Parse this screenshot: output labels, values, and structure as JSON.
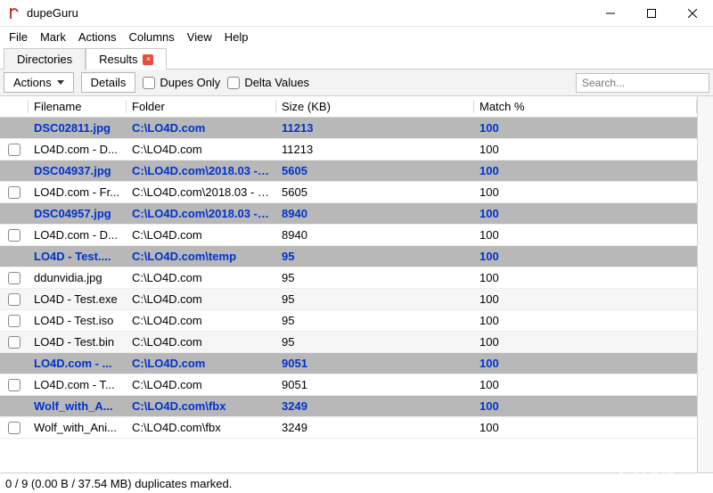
{
  "window": {
    "title": "dupeGuru"
  },
  "menubar": [
    "File",
    "Mark",
    "Actions",
    "Columns",
    "View",
    "Help"
  ],
  "tabs": {
    "items": [
      "Directories",
      "Results"
    ],
    "active": 1,
    "closable": [
      false,
      true
    ]
  },
  "toolbar": {
    "actions_label": "Actions",
    "details_label": "Details",
    "dupes_only_label": "Dupes Only",
    "delta_values_label": "Delta Values",
    "search_placeholder": "Search..."
  },
  "columns": {
    "checkbox": "",
    "filename": "Filename",
    "folder": "Folder",
    "size": "Size (KB)",
    "match": "Match %"
  },
  "rows": [
    {
      "group": true,
      "filename": "DSC02811.jpg",
      "folder": "C:\\LO4D.com",
      "size": "11213",
      "match": "100"
    },
    {
      "group": false,
      "checkbox": true,
      "filename": "LO4D.com - D...",
      "folder": "C:\\LO4D.com",
      "size": "11213",
      "match": "100",
      "alt": false
    },
    {
      "group": true,
      "filename": "DSC04937.jpg",
      "folder": "C:\\LO4D.com\\2018.03 - G...",
      "size": "5605",
      "match": "100"
    },
    {
      "group": false,
      "checkbox": true,
      "filename": "LO4D.com - Fr...",
      "folder": "C:\\LO4D.com\\2018.03 - Gib...",
      "size": "5605",
      "match": "100",
      "alt": false
    },
    {
      "group": true,
      "filename": "DSC04957.jpg",
      "folder": "C:\\LO4D.com\\2018.03 - G...",
      "size": "8940",
      "match": "100"
    },
    {
      "group": false,
      "checkbox": true,
      "filename": "LO4D.com - D...",
      "folder": "C:\\LO4D.com",
      "size": "8940",
      "match": "100",
      "alt": false
    },
    {
      "group": true,
      "filename": "LO4D - Test....",
      "folder": "C:\\LO4D.com\\temp",
      "size": "95",
      "match": "100"
    },
    {
      "group": false,
      "checkbox": true,
      "filename": "ddunvidia.jpg",
      "folder": "C:\\LO4D.com",
      "size": "95",
      "match": "100",
      "alt": false
    },
    {
      "group": false,
      "checkbox": true,
      "filename": "LO4D - Test.exe",
      "folder": "C:\\LO4D.com",
      "size": "95",
      "match": "100",
      "alt": true
    },
    {
      "group": false,
      "checkbox": true,
      "filename": "LO4D - Test.iso",
      "folder": "C:\\LO4D.com",
      "size": "95",
      "match": "100",
      "alt": false
    },
    {
      "group": false,
      "checkbox": true,
      "filename": "LO4D - Test.bin",
      "folder": "C:\\LO4D.com",
      "size": "95",
      "match": "100",
      "alt": true
    },
    {
      "group": true,
      "filename": "LO4D.com - ...",
      "folder": "C:\\LO4D.com",
      "size": "9051",
      "match": "100"
    },
    {
      "group": false,
      "checkbox": true,
      "filename": "LO4D.com - T...",
      "folder": "C:\\LO4D.com",
      "size": "9051",
      "match": "100",
      "alt": false
    },
    {
      "group": true,
      "filename": "Wolf_with_A...",
      "folder": "C:\\LO4D.com\\fbx",
      "size": "3249",
      "match": "100"
    },
    {
      "group": false,
      "checkbox": true,
      "filename": "Wolf_with_Ani...",
      "folder": "C:\\LO4D.com\\fbx",
      "size": "3249",
      "match": "100",
      "alt": false
    }
  ],
  "status": "0 / 9 (0.00 B / 37.54 MB) duplicates marked.",
  "watermark": "LO4D.com"
}
